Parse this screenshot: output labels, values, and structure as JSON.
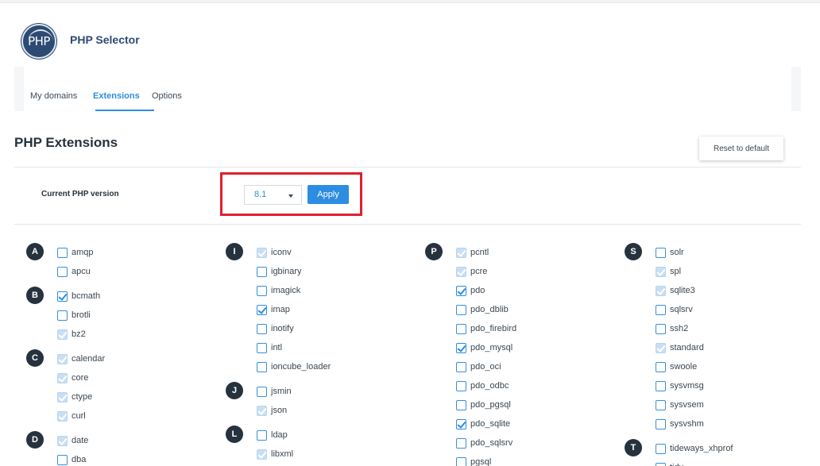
{
  "app": {
    "logo_text": "PHP",
    "title": "PHP Selector"
  },
  "tabs": [
    {
      "label": "My domains",
      "active": false
    },
    {
      "label": "Extensions",
      "active": true
    },
    {
      "label": "Options",
      "active": false
    }
  ],
  "section_title": "PHP Extensions",
  "reset_label": "Reset to default",
  "version": {
    "label": "Current PHP version",
    "selected": "8.1",
    "apply_label": "Apply"
  },
  "columns": [
    {
      "groups": [
        {
          "letter": "A",
          "items": [
            {
              "name": "amqp",
              "state": "off"
            },
            {
              "name": "apcu",
              "state": "off"
            }
          ]
        },
        {
          "letter": "B",
          "items": [
            {
              "name": "bcmath",
              "state": "on"
            },
            {
              "name": "brotli",
              "state": "off"
            },
            {
              "name": "bz2",
              "state": "default"
            }
          ]
        },
        {
          "letter": "C",
          "items": [
            {
              "name": "calendar",
              "state": "default"
            },
            {
              "name": "core",
              "state": "default"
            },
            {
              "name": "ctype",
              "state": "default"
            },
            {
              "name": "curl",
              "state": "default"
            }
          ]
        },
        {
          "letter": "D",
          "items": [
            {
              "name": "date",
              "state": "default"
            },
            {
              "name": "dba",
              "state": "off"
            }
          ]
        }
      ]
    },
    {
      "groups": [
        {
          "letter": "I",
          "items": [
            {
              "name": "iconv",
              "state": "default"
            },
            {
              "name": "igbinary",
              "state": "off"
            },
            {
              "name": "imagick",
              "state": "off"
            },
            {
              "name": "imap",
              "state": "on"
            },
            {
              "name": "inotify",
              "state": "off"
            },
            {
              "name": "intl",
              "state": "off"
            },
            {
              "name": "ioncube_loader",
              "state": "off"
            }
          ]
        },
        {
          "letter": "J",
          "items": [
            {
              "name": "jsmin",
              "state": "off"
            },
            {
              "name": "json",
              "state": "default"
            }
          ]
        },
        {
          "letter": "L",
          "items": [
            {
              "name": "ldap",
              "state": "off"
            },
            {
              "name": "libxml",
              "state": "default"
            }
          ]
        }
      ]
    },
    {
      "groups": [
        {
          "letter": "P",
          "items": [
            {
              "name": "pcntl",
              "state": "default"
            },
            {
              "name": "pcre",
              "state": "default"
            },
            {
              "name": "pdo",
              "state": "on"
            },
            {
              "name": "pdo_dblib",
              "state": "off"
            },
            {
              "name": "pdo_firebird",
              "state": "off"
            },
            {
              "name": "pdo_mysql",
              "state": "on"
            },
            {
              "name": "pdo_oci",
              "state": "off"
            },
            {
              "name": "pdo_odbc",
              "state": "off"
            },
            {
              "name": "pdo_pgsql",
              "state": "off"
            },
            {
              "name": "pdo_sqlite",
              "state": "on"
            },
            {
              "name": "pdo_sqlsrv",
              "state": "off"
            },
            {
              "name": "pgsql",
              "state": "off"
            }
          ]
        }
      ]
    },
    {
      "groups": [
        {
          "letter": "S",
          "items": [
            {
              "name": "solr",
              "state": "off"
            },
            {
              "name": "spl",
              "state": "default"
            },
            {
              "name": "sqlite3",
              "state": "default"
            },
            {
              "name": "sqlsrv",
              "state": "off"
            },
            {
              "name": "ssh2",
              "state": "off"
            },
            {
              "name": "standard",
              "state": "default"
            },
            {
              "name": "swoole",
              "state": "off"
            },
            {
              "name": "sysvmsg",
              "state": "off"
            },
            {
              "name": "sysvsem",
              "state": "off"
            },
            {
              "name": "sysvshm",
              "state": "off"
            }
          ]
        },
        {
          "letter": "T",
          "items": [
            {
              "name": "tideways_xhprof",
              "state": "off"
            },
            {
              "name": "tidy",
              "state": "off"
            }
          ]
        }
      ]
    }
  ]
}
